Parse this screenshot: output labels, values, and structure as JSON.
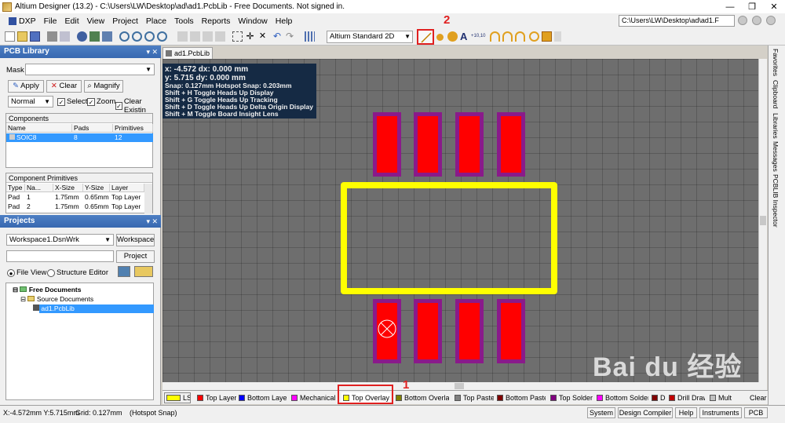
{
  "window": {
    "title": "Altium Designer (13.2) - C:\\Users\\LW\\Desktop\\ad\\ad1.PcbLib - Free Documents. Not signed in.",
    "controls": [
      "—",
      "❐",
      "✕"
    ]
  },
  "menu": {
    "items": [
      "DXP",
      "File",
      "Edit",
      "View",
      "Project",
      "Place",
      "Tools",
      "Reports",
      "Window",
      "Help"
    ],
    "path": "C:\\Users\\LW\\Desktop\\ad\\ad1.F"
  },
  "toolbar": {
    "view_mode": "Altium Standard 2D",
    "annotation_2": "2"
  },
  "pcb_library": {
    "title": "PCB Library",
    "controls": "▾ ✕",
    "mask_label": "Mask",
    "apply": "Apply",
    "clear": "Clear",
    "magnify": "Magnify",
    "mode": "Normal",
    "select": "Select",
    "zoom": "Zoom",
    "clear_existing": "Clear Existin",
    "components": {
      "title": "Components",
      "headers": [
        "Name",
        "Pads",
        "Primitives"
      ],
      "rows": [
        {
          "name": "SOIC8",
          "pads": "8",
          "primitives": "12"
        }
      ]
    },
    "primitives": {
      "title": "Component Primitives",
      "headers": [
        "Type",
        "Na...",
        "X-Size",
        "Y-Size",
        "Layer"
      ],
      "rows": [
        {
          "type": "Pad",
          "name": "1",
          "x": "1.75mm",
          "y": "0.65mm",
          "layer": "Top Layer"
        },
        {
          "type": "Pad",
          "name": "2",
          "x": "1.75mm",
          "y": "0.65mm",
          "layer": "Top Layer"
        }
      ]
    }
  },
  "projects": {
    "title": "Projects",
    "workspace_value": "Workspace1.DsnWrk",
    "workspace_btn": "Workspace",
    "project_btn": "Project",
    "file_view": "File View",
    "structure_editor": "Structure Editor",
    "tree": [
      "Free Documents",
      "Source Documents",
      "ad1.PcbLib"
    ]
  },
  "document": {
    "tab": "ad1.PcbLib",
    "hud": {
      "line1": "x: -4.572   dx: 0.000 mm",
      "line2": "y: 5.715   dy: 0.000 mm",
      "line3": "Snap: 0.127mm Hotspot Snap: 0.203mm",
      "line4": "Shift + H   Toggle Heads Up Display",
      "line5": "Shift + G   Toggle Heads Up Tracking",
      "line6": "Shift + D   Toggle Heads Up Delta Origin Display",
      "line7": "Shift + M   Toggle Board Insight Lens"
    }
  },
  "layers": {
    "tabs": [
      {
        "label": "LS",
        "color": "#ffff00"
      },
      {
        "label": "Top Layer",
        "color": "#ff0000"
      },
      {
        "label": "Bottom Layer",
        "color": "#0000ff"
      },
      {
        "label": "Mechanical",
        "color": "#ff00ff"
      },
      {
        "label": "Top Overlay",
        "color": "#ffff00"
      },
      {
        "label": "Bottom Overlay",
        "color": "#808000"
      },
      {
        "label": "Top Paste",
        "color": "#808080"
      },
      {
        "label": "Bottom Paste",
        "color": "#800000"
      },
      {
        "label": "Top Solder",
        "color": "#800080"
      },
      {
        "label": "Bottom Solder",
        "color": "#ff00ff"
      },
      {
        "label": "Dr",
        "color": "#800000"
      },
      {
        "label": "Drill Draw",
        "color": "#c00000"
      },
      {
        "label": "Mult",
        "color": "#c0c0c0"
      }
    ],
    "clear": "Clear",
    "annotation_1": "1"
  },
  "right_panels": [
    "Favorites",
    "Clipboard",
    "Libraries",
    "Messages",
    "PCBLIB Inspector"
  ],
  "status": {
    "coords": "X:-4.572mm Y:5.715mm",
    "grid": "Grid: 0.127mm",
    "snap": "(Hotspot Snap)",
    "buttons": [
      "System",
      "Design Compiler",
      "Help",
      "Instruments",
      "PCB"
    ]
  },
  "watermark": "Bai du 经验"
}
